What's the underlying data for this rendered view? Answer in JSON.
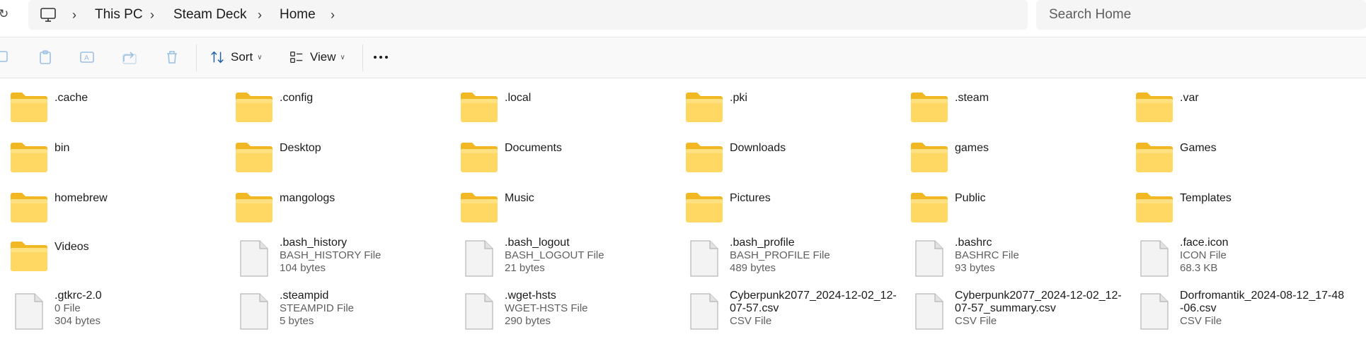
{
  "address": {
    "crumbs": [
      "This PC",
      "Steam Deck",
      "Home"
    ],
    "search_placeholder": "Search Home"
  },
  "toolbar": {
    "sort_label": "Sort",
    "view_label": "View"
  },
  "colors": {
    "folder_body": "#ffd863",
    "folder_back": "#f2b824",
    "file_page": "#f3f3f3",
    "accent": "#005fb8"
  },
  "items": [
    {
      "name": ".cache",
      "kind": "folder"
    },
    {
      "name": ".config",
      "kind": "folder"
    },
    {
      "name": ".local",
      "kind": "folder"
    },
    {
      "name": ".pki",
      "kind": "folder"
    },
    {
      "name": ".steam",
      "kind": "folder"
    },
    {
      "name": ".var",
      "kind": "folder"
    },
    {
      "name": "bin",
      "kind": "folder"
    },
    {
      "name": "Desktop",
      "kind": "folder"
    },
    {
      "name": "Documents",
      "kind": "folder"
    },
    {
      "name": "Downloads",
      "kind": "folder"
    },
    {
      "name": "games",
      "kind": "folder"
    },
    {
      "name": "Games",
      "kind": "folder"
    },
    {
      "name": "homebrew",
      "kind": "folder"
    },
    {
      "name": "mangologs",
      "kind": "folder"
    },
    {
      "name": "Music",
      "kind": "folder"
    },
    {
      "name": "Pictures",
      "kind": "folder"
    },
    {
      "name": "Public",
      "kind": "folder"
    },
    {
      "name": "Templates",
      "kind": "folder"
    },
    {
      "name": "Videos",
      "kind": "folder"
    },
    {
      "name": ".bash_history",
      "kind": "file",
      "type": "BASH_HISTORY File",
      "size": "104 bytes"
    },
    {
      "name": ".bash_logout",
      "kind": "file",
      "type": "BASH_LOGOUT File",
      "size": "21 bytes"
    },
    {
      "name": ".bash_profile",
      "kind": "file",
      "type": "BASH_PROFILE File",
      "size": "489 bytes"
    },
    {
      "name": ".bashrc",
      "kind": "file",
      "type": "BASHRC File",
      "size": "93 bytes"
    },
    {
      "name": ".face.icon",
      "kind": "file",
      "type": "ICON File",
      "size": "68.3 KB"
    },
    {
      "name": ".gtkrc-2.0",
      "kind": "file",
      "type": "0 File",
      "size": "304 bytes"
    },
    {
      "name": ".steampid",
      "kind": "file",
      "type": "STEAMPID File",
      "size": "5 bytes"
    },
    {
      "name": ".wget-hsts",
      "kind": "file",
      "type": "WGET-HSTS File",
      "size": "290 bytes"
    },
    {
      "name": "Cyberpunk2077_2024-12-02_12-07-57.csv",
      "name_lines": [
        "Cyberpunk2077_2024-12-02_12-",
        "07-57.csv"
      ],
      "kind": "file",
      "type": "CSV File"
    },
    {
      "name": "Cyberpunk2077_2024-12-02_12-07-57_summary.csv",
      "name_lines": [
        "Cyberpunk2077_2024-12-02_12-",
        "07-57_summary.csv"
      ],
      "kind": "file",
      "type": "CSV File"
    },
    {
      "name": "Dorfromantik_2024-08-12_17-48-06.csv",
      "name_lines": [
        "Dorfromantik_2024-08-12_17-48",
        "-06.csv"
      ],
      "kind": "file",
      "type": "CSV File"
    }
  ]
}
